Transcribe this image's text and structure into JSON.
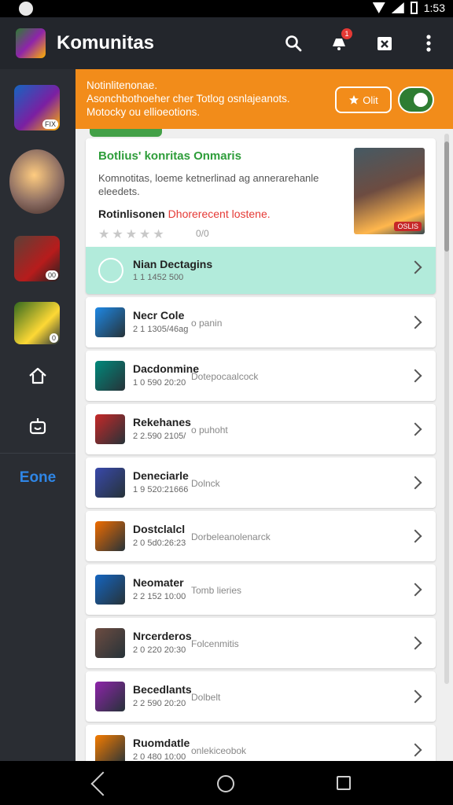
{
  "status_bar": {
    "time": "1:53",
    "icons": [
      "globe-icon",
      "wifi-icon",
      "signal-icon",
      "battery-icon"
    ]
  },
  "app_bar": {
    "title": "Komunitas",
    "notification_count": "1",
    "actions": [
      "search-icon",
      "bell-icon",
      "clipboard-icon",
      "more-icon"
    ]
  },
  "sidebar": {
    "thumbs": [
      {
        "label": "FIX"
      },
      {
        "label": ""
      },
      {
        "badge": "00"
      },
      {
        "badge": "0"
      }
    ],
    "label": "Eone"
  },
  "banner": {
    "title": "Notinlitenonae.",
    "body": "Asonchbothoeher cher Totlog osnlajeanots. Motocky ou ellioeotions.",
    "button_label": "Olit"
  },
  "feature": {
    "title": "Botlius' konritas Onmaris",
    "desc": "Komnotitas, loeme ketnerlinad ag annerarehanle eleedets.",
    "sub_label": "Rotinlisonen",
    "sub_warn": "Dhorerecent lostene.",
    "rating": "0/0",
    "image_badge": "OSLIS"
  },
  "highlight": {
    "title": "Nian Dectagins",
    "meta": "1 1 1452 500"
  },
  "list": [
    {
      "title": "Necr Cole",
      "meta": "2 1 1305/46ag",
      "desc": "o panin",
      "color": "#1e88e5"
    },
    {
      "title": "Dacdonmine",
      "meta": "1 0 590 20:20",
      "desc": "Dotepocaalcock",
      "color": "#00897b"
    },
    {
      "title": "Rekehanes",
      "meta": "2 2.590 2105/",
      "desc": "o puhoht",
      "color": "#c62828"
    },
    {
      "title": "Deneciarle",
      "meta": "1 9 520:21666",
      "desc": "Dolnck",
      "color": "#3949ab"
    },
    {
      "title": "Dostclalcl",
      "meta": "2 0 5d0:26:23",
      "desc": "Dorbeleanolenarck",
      "color": "#ef6c00"
    },
    {
      "title": "Neomater",
      "meta": "2 2 152 10:00",
      "desc": "Tomb lieries",
      "color": "#1565c0"
    },
    {
      "title": "Nrcerderos",
      "meta": "2 0 220 20:30",
      "desc": "Folcenmitis",
      "color": "#6d4c41"
    },
    {
      "title": "Becedlants",
      "meta": "2 2 590 20:20",
      "desc": "Dolbelt",
      "color": "#8e24aa"
    },
    {
      "title": "Ruomdatle",
      "meta": "2 0 480 10:00",
      "desc": "onlekiceobok",
      "color": "#f57c00"
    }
  ]
}
